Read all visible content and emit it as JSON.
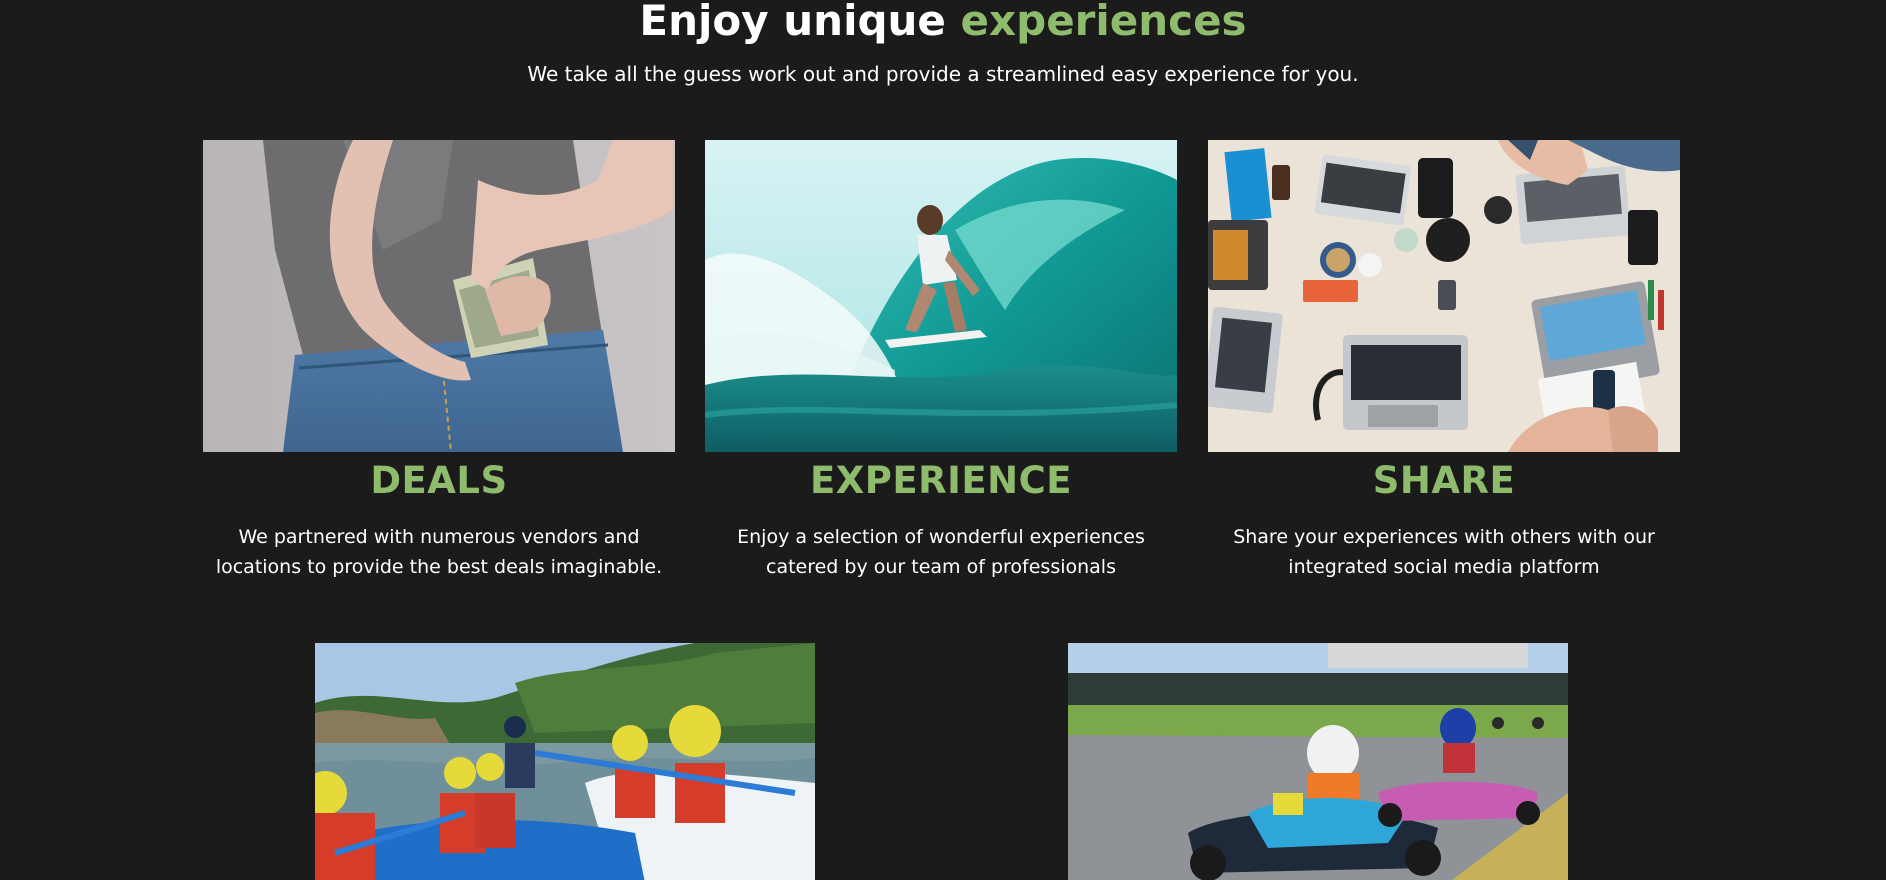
{
  "section": {
    "heading_main": "Enjoy unique ",
    "heading_accent": "experiences",
    "subtitle": "We take all the guess work out and provide a streamlined easy experience for you."
  },
  "colors": {
    "background": "#1b1b1b",
    "accent": "#8fbb6c",
    "text": "#ffffff"
  },
  "cards": [
    {
      "title": "DEALS",
      "text": "We partnered with numerous vendors and locations to provide the best deals imaginable.",
      "image": "money-in-jeans-pocket-photo"
    },
    {
      "title": "EXPERIENCE",
      "text": "Enjoy a selection of wonderful experiences catered by our team of professionals",
      "image": "surfer-in-wave-photo"
    },
    {
      "title": "SHARE",
      "text": "Share your experiences with others with our integrated social media platform",
      "image": "laptops-on-table-photo"
    }
  ],
  "gallery": [
    {
      "image": "river-rafting-photo"
    },
    {
      "image": "go-kart-racing-photo"
    }
  ]
}
